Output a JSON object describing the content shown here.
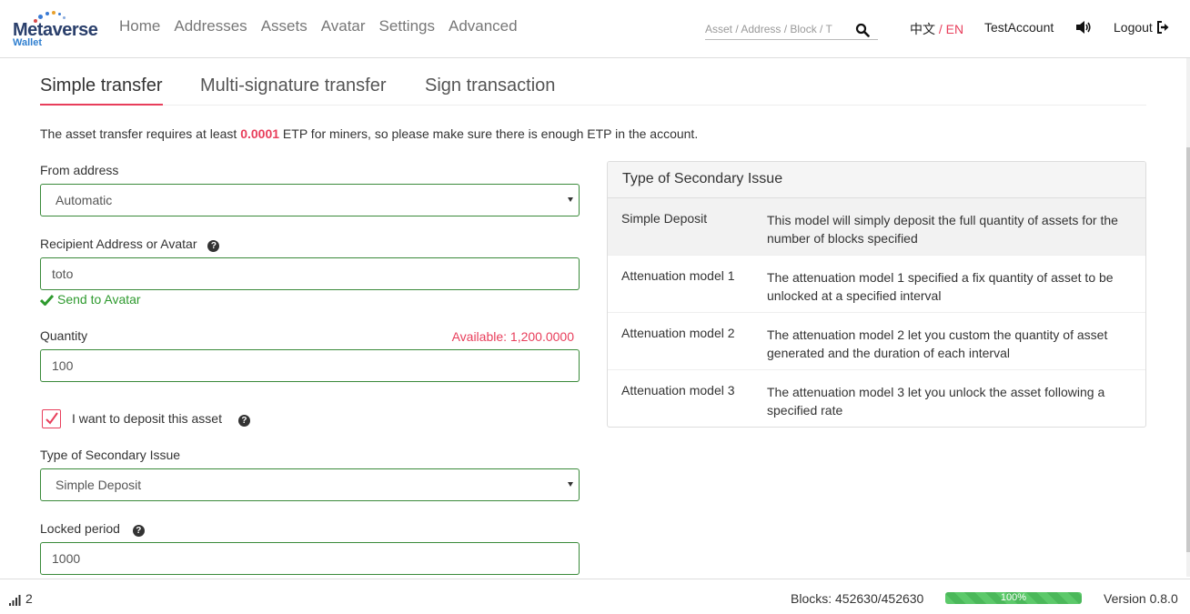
{
  "brand": {
    "name": "Metaverse",
    "sub": "Wallet"
  },
  "nav": [
    "Home",
    "Addresses",
    "Assets",
    "Avatar",
    "Settings",
    "Advanced"
  ],
  "search": {
    "placeholder": "Asset / Address / Block / T"
  },
  "lang": {
    "zh": "中文",
    "sep": "/",
    "en": "EN"
  },
  "account": "TestAccount",
  "logout": "Logout",
  "tabs": [
    "Simple transfer",
    "Multi-signature transfer",
    "Sign transaction"
  ],
  "notice": {
    "pre": "The asset transfer requires at least ",
    "amount": "0.0001",
    "post": " ETP for miners, so please make sure there is enough ETP in the account."
  },
  "form": {
    "from_label": "From address",
    "from_value": "Automatic",
    "recipient_label": "Recipient Address or Avatar",
    "recipient_value": "toto",
    "recipient_ok": "Send to Avatar",
    "quantity_label": "Quantity",
    "available": "Available: 1,200.0000",
    "quantity_value": "100",
    "deposit_label": "I want to deposit this asset",
    "deposit_checked": true,
    "issue_label": "Type of Secondary Issue",
    "issue_value": "Simple Deposit",
    "locked_label": "Locked period",
    "locked_value": "1000"
  },
  "panel": {
    "title": "Type of Secondary Issue",
    "rows": [
      {
        "name": "Simple Deposit",
        "desc": "This model will simply deposit the full quantity of assets for the number of blocks specified"
      },
      {
        "name": "Attenuation model 1",
        "desc": "The attenuation model 1 specified a fix quantity of asset to be unlocked at a specified interval"
      },
      {
        "name": "Attenuation model 2",
        "desc": "The attenuation model 2 let you custom the quantity of asset generated and the duration of each interval"
      },
      {
        "name": "Attenuation model 3",
        "desc": "The attenuation model 3 let you unlock the asset following a specified rate"
      }
    ]
  },
  "footer": {
    "peers": "2",
    "blocks": "Blocks: 452630/452630",
    "progress_percent": 100,
    "progress_label": "100%",
    "version": "Version 0.8.0"
  },
  "colors": {
    "accent": "#e83e5b",
    "success": "#2e9a2e",
    "field_border": "#3a8a3a"
  }
}
